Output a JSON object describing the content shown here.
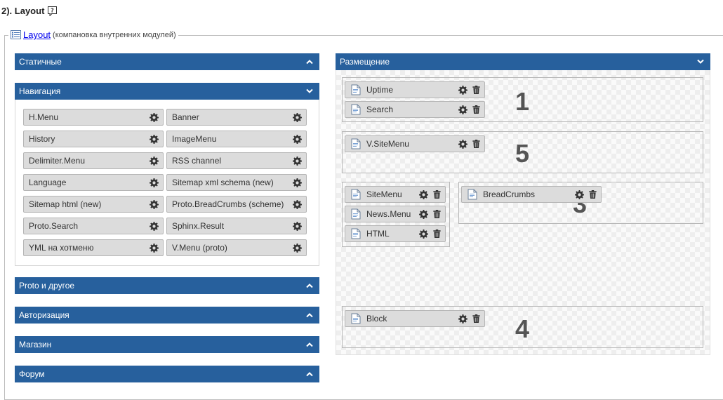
{
  "page": {
    "heading": "2). Layout"
  },
  "legend": {
    "link": "Layout",
    "note": "(компановка внутренних модулей)"
  },
  "left_panels": {
    "static": "Статичные",
    "navigation": "Навигация",
    "proto": "Proto и другое",
    "auth": "Авторизация",
    "shop": "Магазин",
    "forum": "Форум"
  },
  "navigation_modules": {
    "left": [
      "H.Menu",
      "History",
      "Delimiter.Menu",
      "Language",
      "Sitemap html (new)",
      "Proto.Search",
      "YML на хотменю"
    ],
    "right": [
      "Banner",
      "ImageMenu",
      "RSS channel",
      "Sitemap xml schema (new)",
      "Proto.BreadCrumbs (scheme)",
      "Sphinx.Result",
      "V.Menu (proto)"
    ]
  },
  "placement": {
    "title": "Размещение",
    "zones": {
      "z1": {
        "number": "1",
        "modules": [
          "Uptime",
          "Search"
        ]
      },
      "z5": {
        "number": "5",
        "modules": [
          "V.SiteMenu"
        ]
      },
      "z2": {
        "modules": [
          "SiteMenu",
          "News.Menu",
          "HTML"
        ]
      },
      "z3": {
        "number": "3",
        "modules": [
          "BreadCrumbs"
        ]
      },
      "z4": {
        "number": "4",
        "modules": [
          "Block"
        ]
      }
    }
  },
  "colors": {
    "header_blue": "#27609d",
    "module_bg": "#dcdcdc",
    "link": "#0000ee"
  }
}
